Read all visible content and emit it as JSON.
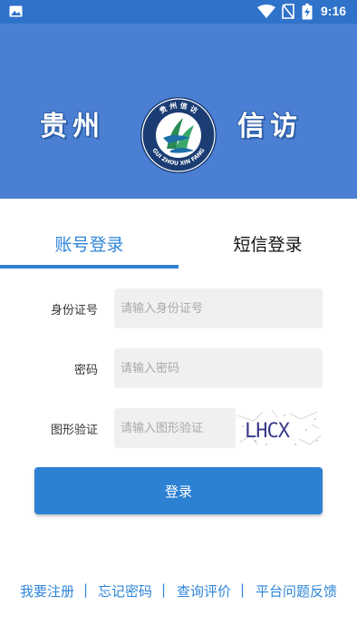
{
  "status_bar": {
    "time": "9:16",
    "icons": [
      "image-icon",
      "wifi-icon",
      "no-sim-icon",
      "battery-icon"
    ]
  },
  "banner": {
    "left_text": "贵州",
    "right_text": "信访",
    "logo_top_text": "贵 州 信 访",
    "logo_bottom_text": "GUI ZHOU XIN FANG"
  },
  "tabs": {
    "account_login": "账号登录",
    "sms_login": "短信登录",
    "active": "account_login"
  },
  "form": {
    "id_label": "身份证号",
    "id_placeholder": "请输入身份证号",
    "password_label": "密码",
    "password_placeholder": "请输入密码",
    "captcha_label": "图形验证",
    "captcha_placeholder": "请输入图形验证",
    "captcha_text": "LHCX"
  },
  "login_button": "登录",
  "footer": {
    "register": "我要注册",
    "forgot_password": "忘记密码",
    "query_evaluation": "查询评价",
    "feedback": "平台问题反馈",
    "separator": "|"
  },
  "colors": {
    "status_bar": "#2f72c9",
    "banner": "#4a7fd3",
    "accent": "#2f86d8",
    "button": "#2d81d3",
    "input_bg": "#eff0f2"
  }
}
